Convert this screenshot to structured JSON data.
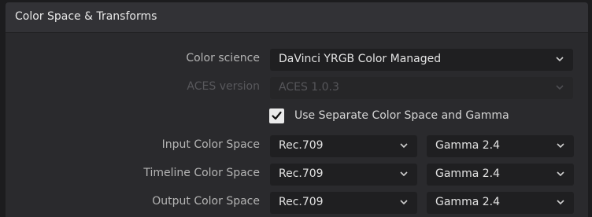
{
  "panel": {
    "title": "Color Space & Transforms"
  },
  "rows": {
    "color_science": {
      "label": "Color science",
      "value": "DaVinci YRGB Color Managed"
    },
    "aces_version": {
      "label": "ACES version",
      "value": "ACES 1.0.3",
      "disabled": true
    },
    "separate": {
      "label": "Use Separate Color Space and Gamma",
      "checked": true
    },
    "input": {
      "label": "Input Color Space",
      "space": "Rec.709",
      "gamma": "Gamma 2.4"
    },
    "timeline": {
      "label": "Timeline Color Space",
      "space": "Rec.709",
      "gamma": "Gamma 2.4"
    },
    "output": {
      "label": "Output Color Space",
      "space": "Rec.709",
      "gamma": "Gamma 2.4"
    }
  },
  "icons": {
    "dropdown_arrow": "chevron-down-icon",
    "checkbox_mark": "checkmark-icon"
  },
  "colors": {
    "panel_bg": "#2a2a2d",
    "header_bg": "#323236",
    "field_bg": "#1f1f21",
    "label_text": "#b4b4b4"
  }
}
